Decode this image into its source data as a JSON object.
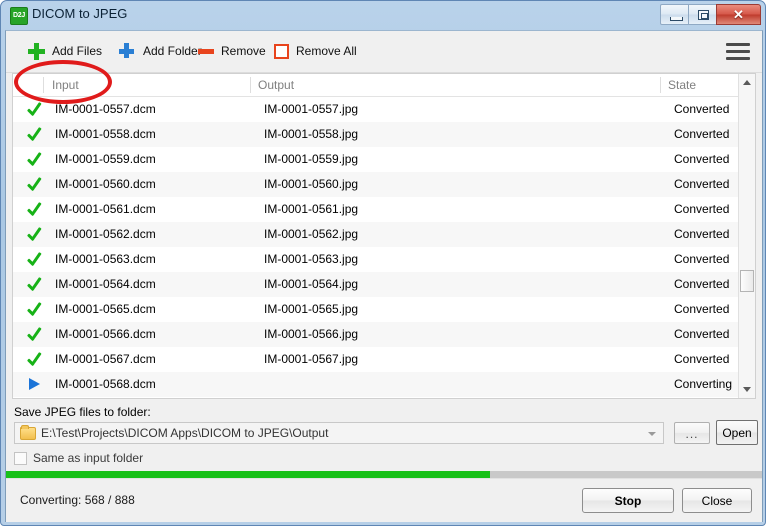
{
  "window": {
    "title": "DICOM to JPEG",
    "app_icon_text": "D2J",
    "minimize_label": "Minimize",
    "maximize_label": "Maximize",
    "close_label": "✕"
  },
  "toolbar": {
    "add_files": "Add Files",
    "add_folder": "Add Folder",
    "remove": "Remove",
    "remove_all": "Remove All",
    "menu_label": "Menu"
  },
  "list": {
    "columns": [
      "Input",
      "Output",
      "State"
    ],
    "rows": [
      {
        "icon": "check",
        "input": "IM-0001-0557.dcm",
        "output": "IM-0001-0557.jpg",
        "state": "Converted"
      },
      {
        "icon": "check",
        "input": "IM-0001-0558.dcm",
        "output": "IM-0001-0558.jpg",
        "state": "Converted"
      },
      {
        "icon": "check",
        "input": "IM-0001-0559.dcm",
        "output": "IM-0001-0559.jpg",
        "state": "Converted"
      },
      {
        "icon": "check",
        "input": "IM-0001-0560.dcm",
        "output": "IM-0001-0560.jpg",
        "state": "Converted"
      },
      {
        "icon": "check",
        "input": "IM-0001-0561.dcm",
        "output": "IM-0001-0561.jpg",
        "state": "Converted"
      },
      {
        "icon": "check",
        "input": "IM-0001-0562.dcm",
        "output": "IM-0001-0562.jpg",
        "state": "Converted"
      },
      {
        "icon": "check",
        "input": "IM-0001-0563.dcm",
        "output": "IM-0001-0563.jpg",
        "state": "Converted"
      },
      {
        "icon": "check",
        "input": "IM-0001-0564.dcm",
        "output": "IM-0001-0564.jpg",
        "state": "Converted"
      },
      {
        "icon": "check",
        "input": "IM-0001-0565.dcm",
        "output": "IM-0001-0565.jpg",
        "state": "Converted"
      },
      {
        "icon": "check",
        "input": "IM-0001-0566.dcm",
        "output": "IM-0001-0566.jpg",
        "state": "Converted"
      },
      {
        "icon": "check",
        "input": "IM-0001-0567.dcm",
        "output": "IM-0001-0567.jpg",
        "state": "Converted"
      },
      {
        "icon": "play",
        "input": "IM-0001-0568.dcm",
        "output": "",
        "state": "Converting"
      }
    ]
  },
  "output_folder": {
    "label": "Save JPEG files to folder:",
    "path": "E:\\Test\\Projects\\DICOM Apps\\DICOM to JPEG\\Output",
    "browse_label": "...",
    "open_label": "Open",
    "same_as_input_label": "Same as input folder",
    "same_as_input_checked": false
  },
  "progress": {
    "percent": 63.96,
    "fill_color": "#18c018",
    "track_color": "#c9c9c9"
  },
  "statusbar": {
    "status_text": "Converting: 568 / 888",
    "current": 568,
    "total": 888,
    "stop_label": "Stop",
    "close_label": "Close"
  },
  "annotation": {
    "shape": "ellipse",
    "color": "#e01b1b",
    "targets": "Add Files"
  }
}
